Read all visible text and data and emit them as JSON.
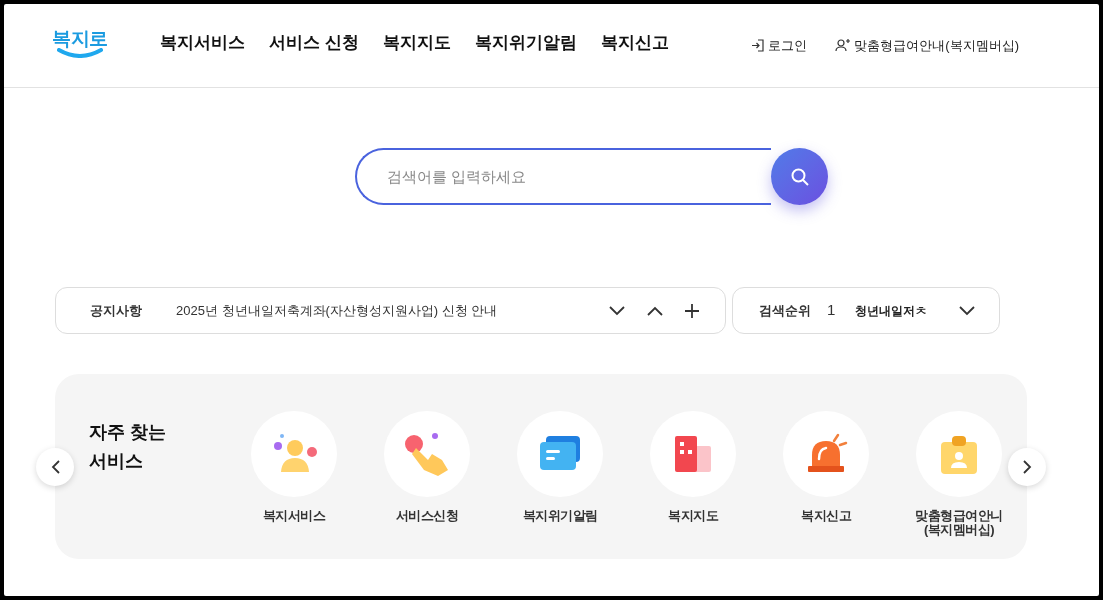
{
  "header": {
    "logo": "복지로",
    "nav": [
      "복지서비스",
      "서비스 신청",
      "복지지도",
      "복지위기알림",
      "복지신고"
    ],
    "login": "로그인",
    "membership": "맞춤형급여안내(복지멤버십)"
  },
  "search": {
    "placeholder": "검색어를 입력하세요"
  },
  "notice": {
    "label": "공지사항",
    "text": "2025년 청년내일저축계좌(자산형성지원사업) 신청 안내"
  },
  "ranking": {
    "label": "검색순위",
    "rank": "1",
    "term": "청년내일저ㅊ"
  },
  "frequent": {
    "title": "자주 찾는\n서비스",
    "items": [
      {
        "kind": "person",
        "label": "복지서비스"
      },
      {
        "kind": "hand",
        "label": "서비스신청"
      },
      {
        "kind": "message",
        "label": "복지위기알림"
      },
      {
        "kind": "building",
        "label": "복지지도"
      },
      {
        "kind": "siren",
        "label": "복지신고"
      },
      {
        "kind": "badge",
        "label": "맞춤형급여안니\n(복지멤버십)"
      }
    ]
  }
}
